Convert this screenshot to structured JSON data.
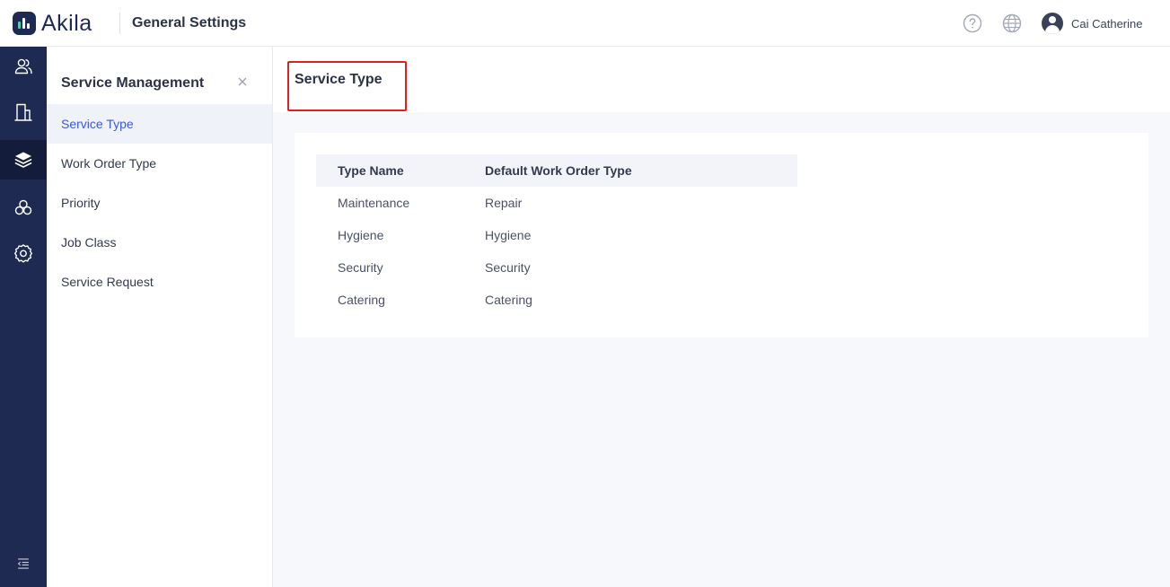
{
  "header": {
    "brand": "Akila",
    "title": "General Settings",
    "user_name": "Cai Catherine",
    "icons": [
      "help-icon",
      "globe-icon",
      "avatar"
    ]
  },
  "rail": {
    "items": [
      "users-icon",
      "building-icon",
      "layers-icon",
      "flower-icon",
      "gear-icon"
    ],
    "active": "layers-icon",
    "collapse_icon": "menu-collapse-icon"
  },
  "submenu": {
    "title": "Service Management",
    "items": [
      {
        "label": "Service Type",
        "active": true
      },
      {
        "label": "Work Order Type",
        "active": false
      },
      {
        "label": "Priority",
        "active": false
      },
      {
        "label": "Job Class",
        "active": false
      },
      {
        "label": "Service Request",
        "active": false
      }
    ]
  },
  "page": {
    "title": "Service Type"
  },
  "table": {
    "columns": [
      "Type Name",
      "Default Work Order Type"
    ],
    "rows": [
      [
        "Maintenance",
        "Repair"
      ],
      [
        "Hygiene",
        "Hygiene"
      ],
      [
        "Security",
        "Security"
      ],
      [
        "Catering",
        "Catering"
      ]
    ]
  },
  "colors": {
    "rail_bg": "#1f2a52",
    "accent": "#3a5ad9",
    "highlight": "#e02020"
  }
}
